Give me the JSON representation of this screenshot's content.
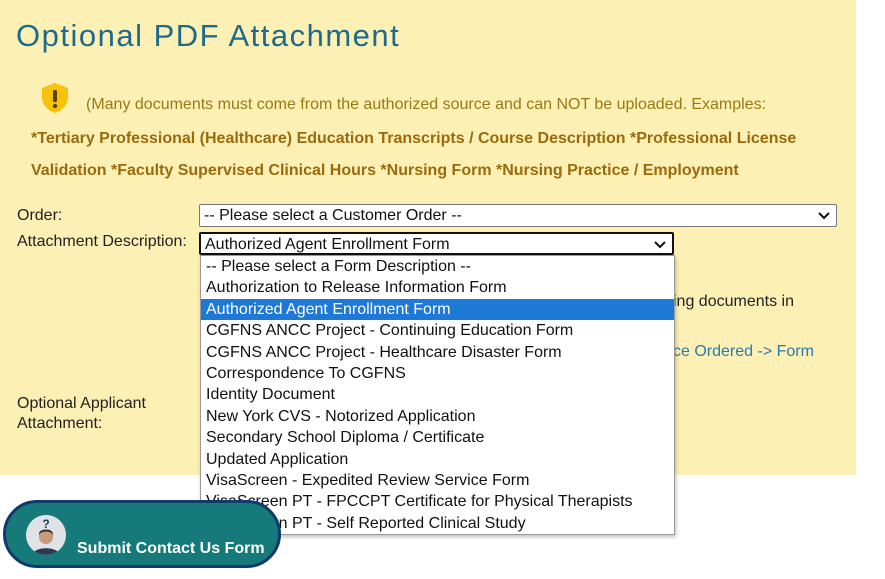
{
  "page": {
    "title": "Optional PDF Attachment"
  },
  "notice": {
    "icon": "shield-warning-icon",
    "intro": "(Many documents must come from the authorized source and can NOT be uploaded. Examples:",
    "line1": "*Tertiary Professional (Healthcare) Education Transcripts / Course Description *Professional License",
    "line2": "Validation *Faculty Supervised Clinical Hours *Nursing Form *Nursing Practice / Employment"
  },
  "form": {
    "order_label": "Order:",
    "order_value": "-- Please select a Customer Order --",
    "description_label": "Attachment Description:",
    "description_value": "Authorized Agent Enrollment Form",
    "partial_text": "ing documents in",
    "partial_link": "ce Ordered -> Form",
    "applicant_label_1": "Optional Applicant",
    "applicant_label_2": "Attachment:"
  },
  "dropdown": {
    "options": [
      "-- Please select a Form Description --",
      "Authorization to Release Information Form",
      "Authorized Agent Enrollment Form",
      "CGFNS ANCC Project - Continuing Education Form",
      "CGFNS ANCC Project - Healthcare Disaster Form",
      "Correspondence To CGFNS",
      "Identity Document",
      "New York CVS - Notorized Application",
      "Secondary School Diploma / Certificate",
      "Updated Application",
      "VisaScreen - Expedited Review Service Form",
      "VisaScreen PT - FPCCPT Certificate for Physical Therapists",
      "VisaScreen PT - Self Reported Clinical Study"
    ],
    "selected_index": 2
  },
  "submit": {
    "label": "Submit Contact Us Form",
    "icon": "help-avatar-icon"
  },
  "colors": {
    "panel_bg": "#fdf0b5",
    "title": "#1e6a8a",
    "notice_text": "#9a6a0c",
    "selected_option": "#1e78d6",
    "submit_bg": "#167a7a",
    "submit_border": "#0f3a6a"
  }
}
